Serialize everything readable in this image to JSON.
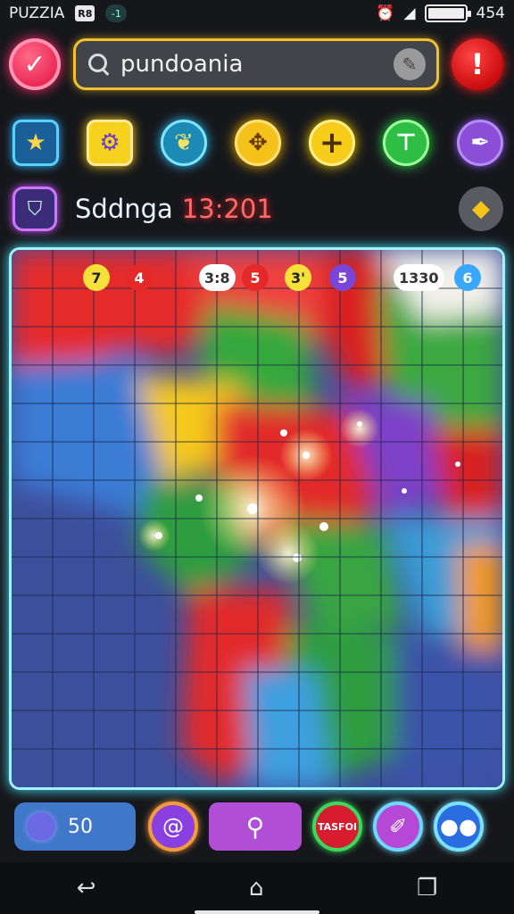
{
  "status_bar": {
    "app_name": "PUZZIA",
    "badge_1": "R8",
    "badge_2": "-1",
    "clock": "454"
  },
  "search": {
    "value": "pundoania"
  },
  "puzzle_info": {
    "name": "Sddnga",
    "timer": "13:201"
  },
  "board_tokens": [
    {
      "label": "7",
      "bg": "#f6e13b",
      "fg": "#222"
    },
    {
      "label": "4",
      "bg": "#e52929",
      "fg": "#fff"
    },
    {
      "label": "3:8",
      "bg": "#ffffff",
      "fg": "#333"
    },
    {
      "label": "5",
      "bg": "#e52929",
      "fg": "#fff"
    },
    {
      "label": "3'",
      "bg": "#f6e13b",
      "fg": "#222"
    },
    {
      "label": "5",
      "bg": "#7b46d6",
      "fg": "#fff"
    },
    {
      "label": "1330",
      "bg": "#ffffff",
      "fg": "#333"
    },
    {
      "label": "6",
      "bg": "#3aa7ff",
      "fg": "#fff"
    }
  ],
  "bottom": {
    "gem_count": "50",
    "transfer_label": "TASFOI"
  },
  "colors": {
    "accent_search_border": "#f2c12e",
    "board_glow": "#48e3ff",
    "alert": "#d91c1c",
    "check": "#e8234f"
  },
  "icons": {
    "check": "check-icon",
    "alert": "exclamation-icon",
    "search": "search-icon",
    "edit": "pen-icon"
  }
}
